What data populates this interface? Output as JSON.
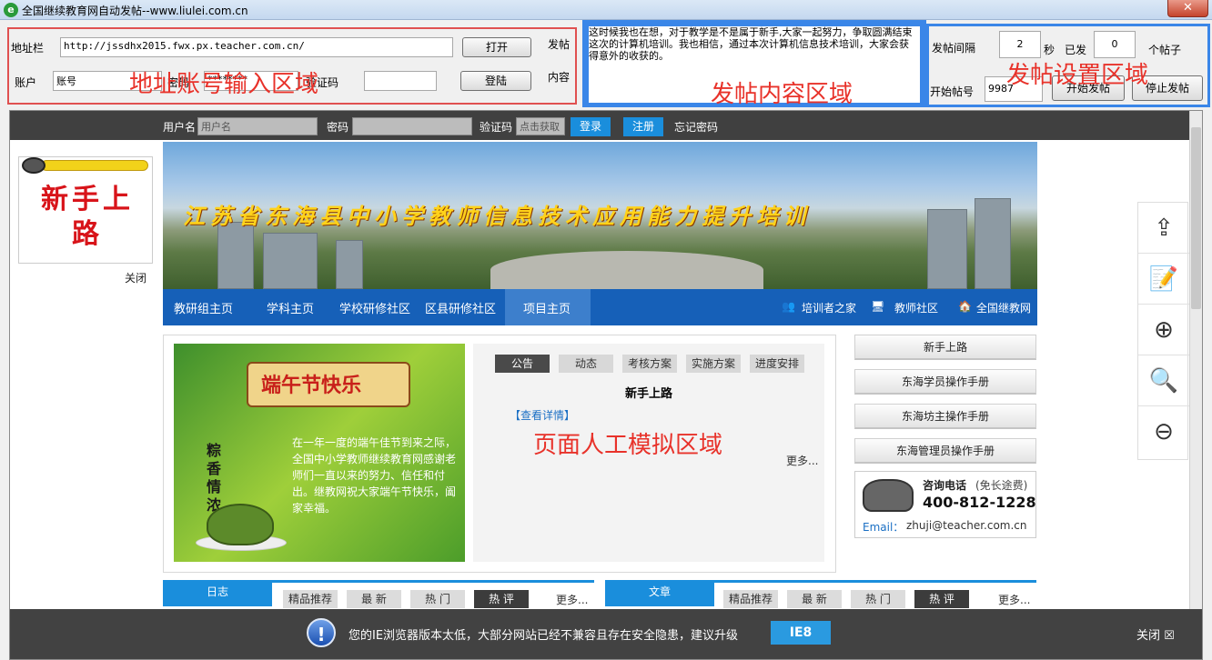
{
  "window": {
    "title": "全国继续教育网自动发帖--www.liulei.com.cn",
    "icon": "app-icon",
    "icon_glyph": "e",
    "close_glyph": "✕"
  },
  "address_section": {
    "address_label": "地址栏",
    "address_value": "http://jssdhx2015.fwx.px.teacher.com.cn/",
    "open_button": "打开",
    "account_label": "账户",
    "account_value": "账号",
    "password_label": "密码",
    "password_value": "********",
    "captcha_label": "验证码",
    "captcha_value": "",
    "login_button": "登陆",
    "overlay": "地址账号输入区域"
  },
  "post_content_section": {
    "label_top": "发帖",
    "label_bottom": "内容",
    "text": "这时候我也在想，对于教学是不是属于新手,大家一起努力，争取圆满结束这次的计算机培训。我也相信，通过本次计算机信息技术培训，大家会获得意外的收获的。",
    "overlay": "发帖内容区域"
  },
  "settings_section": {
    "interval_label": "发帖间隔",
    "interval_value": "2",
    "seconds_label": "秒",
    "sent_label": "已发",
    "sent_value": "0",
    "posts_unit": "个帖子",
    "start_id_label": "开始帖号",
    "start_id_value": "9987",
    "start_button": "开始发帖",
    "stop_button": "停止发帖",
    "overlay": "发帖设置区域"
  },
  "site": {
    "login_bar": {
      "username_label": "用户名",
      "username_placeholder": "用户名",
      "password_label": "密码",
      "captcha_label": "验证码",
      "captcha_button": "点击获取",
      "login_button": "登录",
      "register_button": "注册",
      "forgot_link": "忘记密码"
    },
    "newbie_widget": {
      "text": "新手上路",
      "close_label": "关闭"
    },
    "banner_title": "江苏省东海县中小学教师信息技术应用能力提升培训",
    "nav": [
      "教研组主页",
      "学科主页",
      "学校研修社区",
      "区县研修社区",
      "项目主页"
    ],
    "nav_right": [
      {
        "label": "培训者之家",
        "icon": "people-icon",
        "glyph": "👥"
      },
      {
        "label": "教师社区",
        "icon": "monitor-icon",
        "glyph": "🖥"
      },
      {
        "label": "全国继教网",
        "icon": "home-icon",
        "glyph": "🏠"
      }
    ],
    "promo": {
      "scroll_text": "端午节快乐",
      "vertical_text": "粽香情浓",
      "body": "在一年一度的端午佳节到来之际，全国中小学教师继续教育网感谢老师们一直以来的努力、信任和付出。继教网祝大家端午节快乐，阖家幸福。",
      "overlay": "页面人工模拟区域"
    },
    "notice_tabs": [
      "公告",
      "动态",
      "考核方案",
      "实施方案",
      "进度安排"
    ],
    "notice_title": "新手上路",
    "notice_link": "【查看详情】",
    "notice_more": "更多...",
    "side_links": [
      "新手上路",
      "东海学员操作手册",
      "东海坊主操作手册",
      "东海管理员操作手册"
    ],
    "contact": {
      "phone_label": "咨询电话",
      "phone_note": "(免长途费)",
      "phone": "400-812-1228",
      "email_label": "Email：",
      "email": "zhuji@teacher.com.cn"
    },
    "blog_section": {
      "title": "日志",
      "tabs": [
        "精品推荐",
        "最 新",
        "热 门",
        "热 评"
      ],
      "more": "更多..."
    },
    "article_section": {
      "title": "文章",
      "tabs": [
        "精品推荐",
        "最 新",
        "热 门",
        "热 评"
      ],
      "more": "更多..."
    },
    "float_toolbar": [
      {
        "icon": "back-to-top-icon",
        "glyph": "⇪"
      },
      {
        "icon": "feedback-icon",
        "glyph": "📝"
      },
      {
        "icon": "zoom-in-icon",
        "glyph": "⊕"
      },
      {
        "icon": "zoom-reset-icon",
        "glyph": "🔍"
      },
      {
        "icon": "zoom-out-icon",
        "glyph": "⊖"
      }
    ],
    "ie_warning": {
      "text": "您的IE浏览器版本太低，大部分网站已经不兼容且存在安全隐患，建议升级",
      "button": "IE8",
      "close": "关闭 ☒",
      "alert_glyph": "!"
    }
  }
}
